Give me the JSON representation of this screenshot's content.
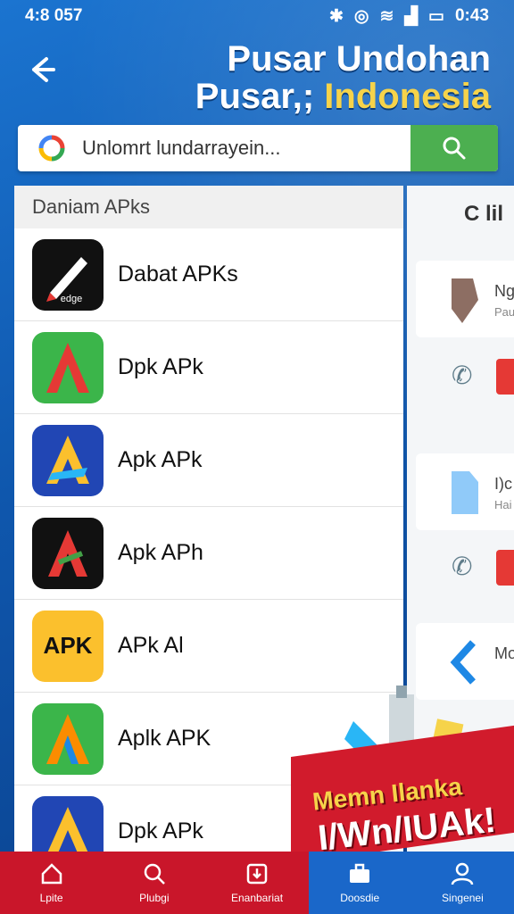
{
  "status": {
    "left": "4:8 057",
    "time": "0:43"
  },
  "header": {
    "title_line1": "Pusar Undohan",
    "title_line2_a": "Pusar,;",
    "title_line2_b": "Indonesia"
  },
  "search": {
    "placeholder": "Unlomrt lundarrayein..."
  },
  "list": {
    "header": "Daniam APks",
    "items": [
      {
        "label": "Dabat APKs",
        "icon_text": "edge"
      },
      {
        "label": "Dpk APk",
        "icon_text": ""
      },
      {
        "label": "Apk APk",
        "icon_text": ""
      },
      {
        "label": "Apk APh",
        "icon_text": ""
      },
      {
        "label": "APk Al",
        "icon_text": "APK"
      },
      {
        "label": "Aplk APK",
        "icon_text": ""
      },
      {
        "label": "Dpk APk",
        "icon_text": ""
      }
    ]
  },
  "right_panel": {
    "header": "C lil",
    "card1": "Ng",
    "card1_sub": "Pau",
    "card2": "I)c",
    "card2_sub": "Hai",
    "card3": "Mo"
  },
  "promo": {
    "line1": "Memn Ilanka",
    "line2": "I/Wn/IUAk!"
  },
  "nav": {
    "items": [
      {
        "label": "Lpite"
      },
      {
        "label": "Plubgi"
      },
      {
        "label": "Enanbariat"
      },
      {
        "label": "Doosdie"
      },
      {
        "label": "Singenei"
      }
    ]
  },
  "colors": {
    "brand_blue": "#1b74d0",
    "accent_yellow": "#f6d34a",
    "nav_red": "#c9162a",
    "search_green": "#4caf50"
  }
}
